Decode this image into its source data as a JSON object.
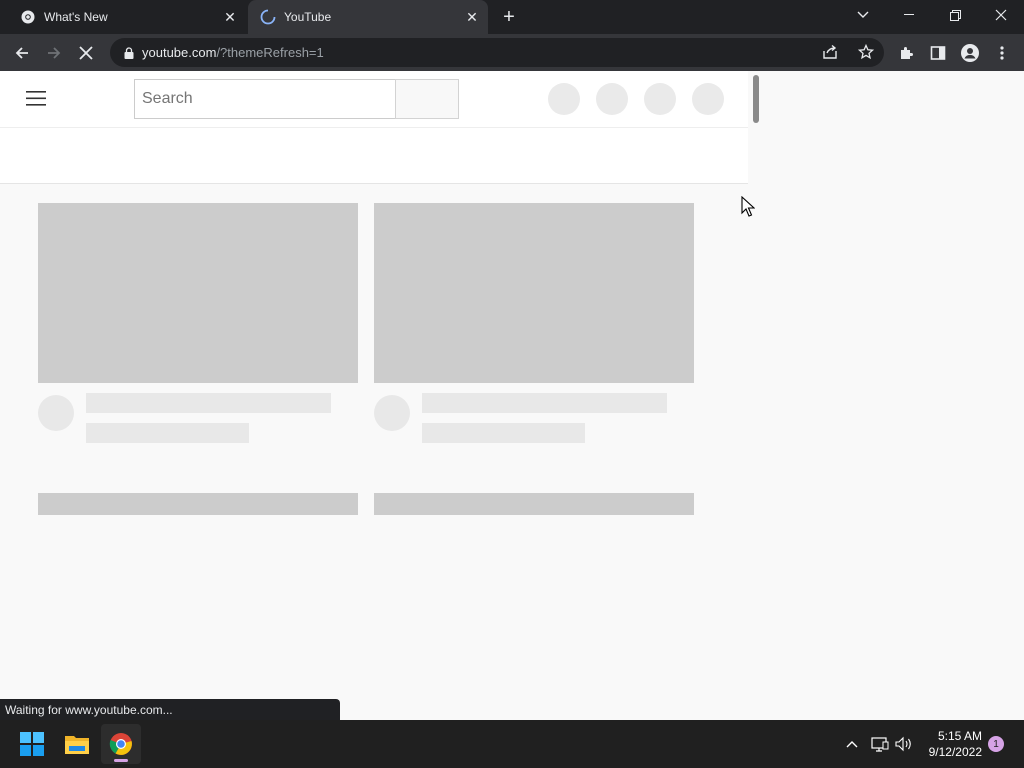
{
  "browser": {
    "tabs": [
      {
        "title": "What's New",
        "icon": "chrome-icon",
        "active": false
      },
      {
        "title": "YouTube",
        "icon": "loading-spinner-icon",
        "active": true
      }
    ],
    "new_tab_label": "+",
    "url_host": "youtube.com",
    "url_path": "/?themeRefresh=1",
    "status_text": "Waiting for www.youtube.com..."
  },
  "youtube": {
    "search_placeholder": "Search"
  },
  "taskbar": {
    "time": "5:15 AM",
    "date": "9/12/2022",
    "notification_count": "1"
  },
  "colors": {
    "tab_bar": "#202124",
    "toolbar": "#35363a",
    "placeholder": "#cccccc",
    "accent": "#d6a3e6"
  }
}
